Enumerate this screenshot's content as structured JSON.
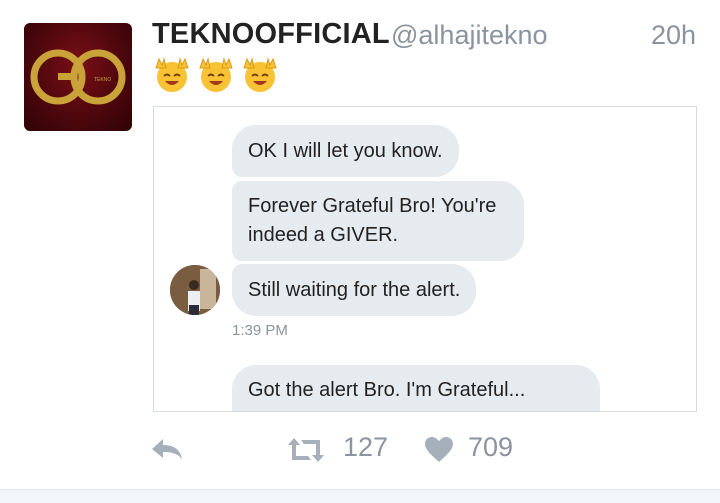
{
  "tweet": {
    "avatar_text": "GO",
    "display_name": "TEKNOOFFICIAL",
    "handle": "@alhajitekno",
    "time": "20h",
    "emoji_icons": [
      "raising-hands-emoji",
      "raising-hands-emoji",
      "raising-hands-emoji"
    ]
  },
  "chat": {
    "messages": [
      {
        "text": "OK I will let you know."
      },
      {
        "text": "Forever Grateful Bro! You're indeed a GIVER."
      },
      {
        "text": "Still waiting for the alert."
      },
      {
        "text": "Got the alert Bro. I'm Grateful..."
      }
    ],
    "timestamp": "1:39 PM"
  },
  "actions": {
    "reply_icon": "reply-icon",
    "retweet_icon": "retweet-icon",
    "retweet_count": "127",
    "like_icon": "heart-icon",
    "like_count": "709"
  },
  "colors": {
    "muted": "#8a949e",
    "bubble": "#e6ebef",
    "avatar_red": "#5c0a10",
    "gold": "#c9a33a"
  }
}
